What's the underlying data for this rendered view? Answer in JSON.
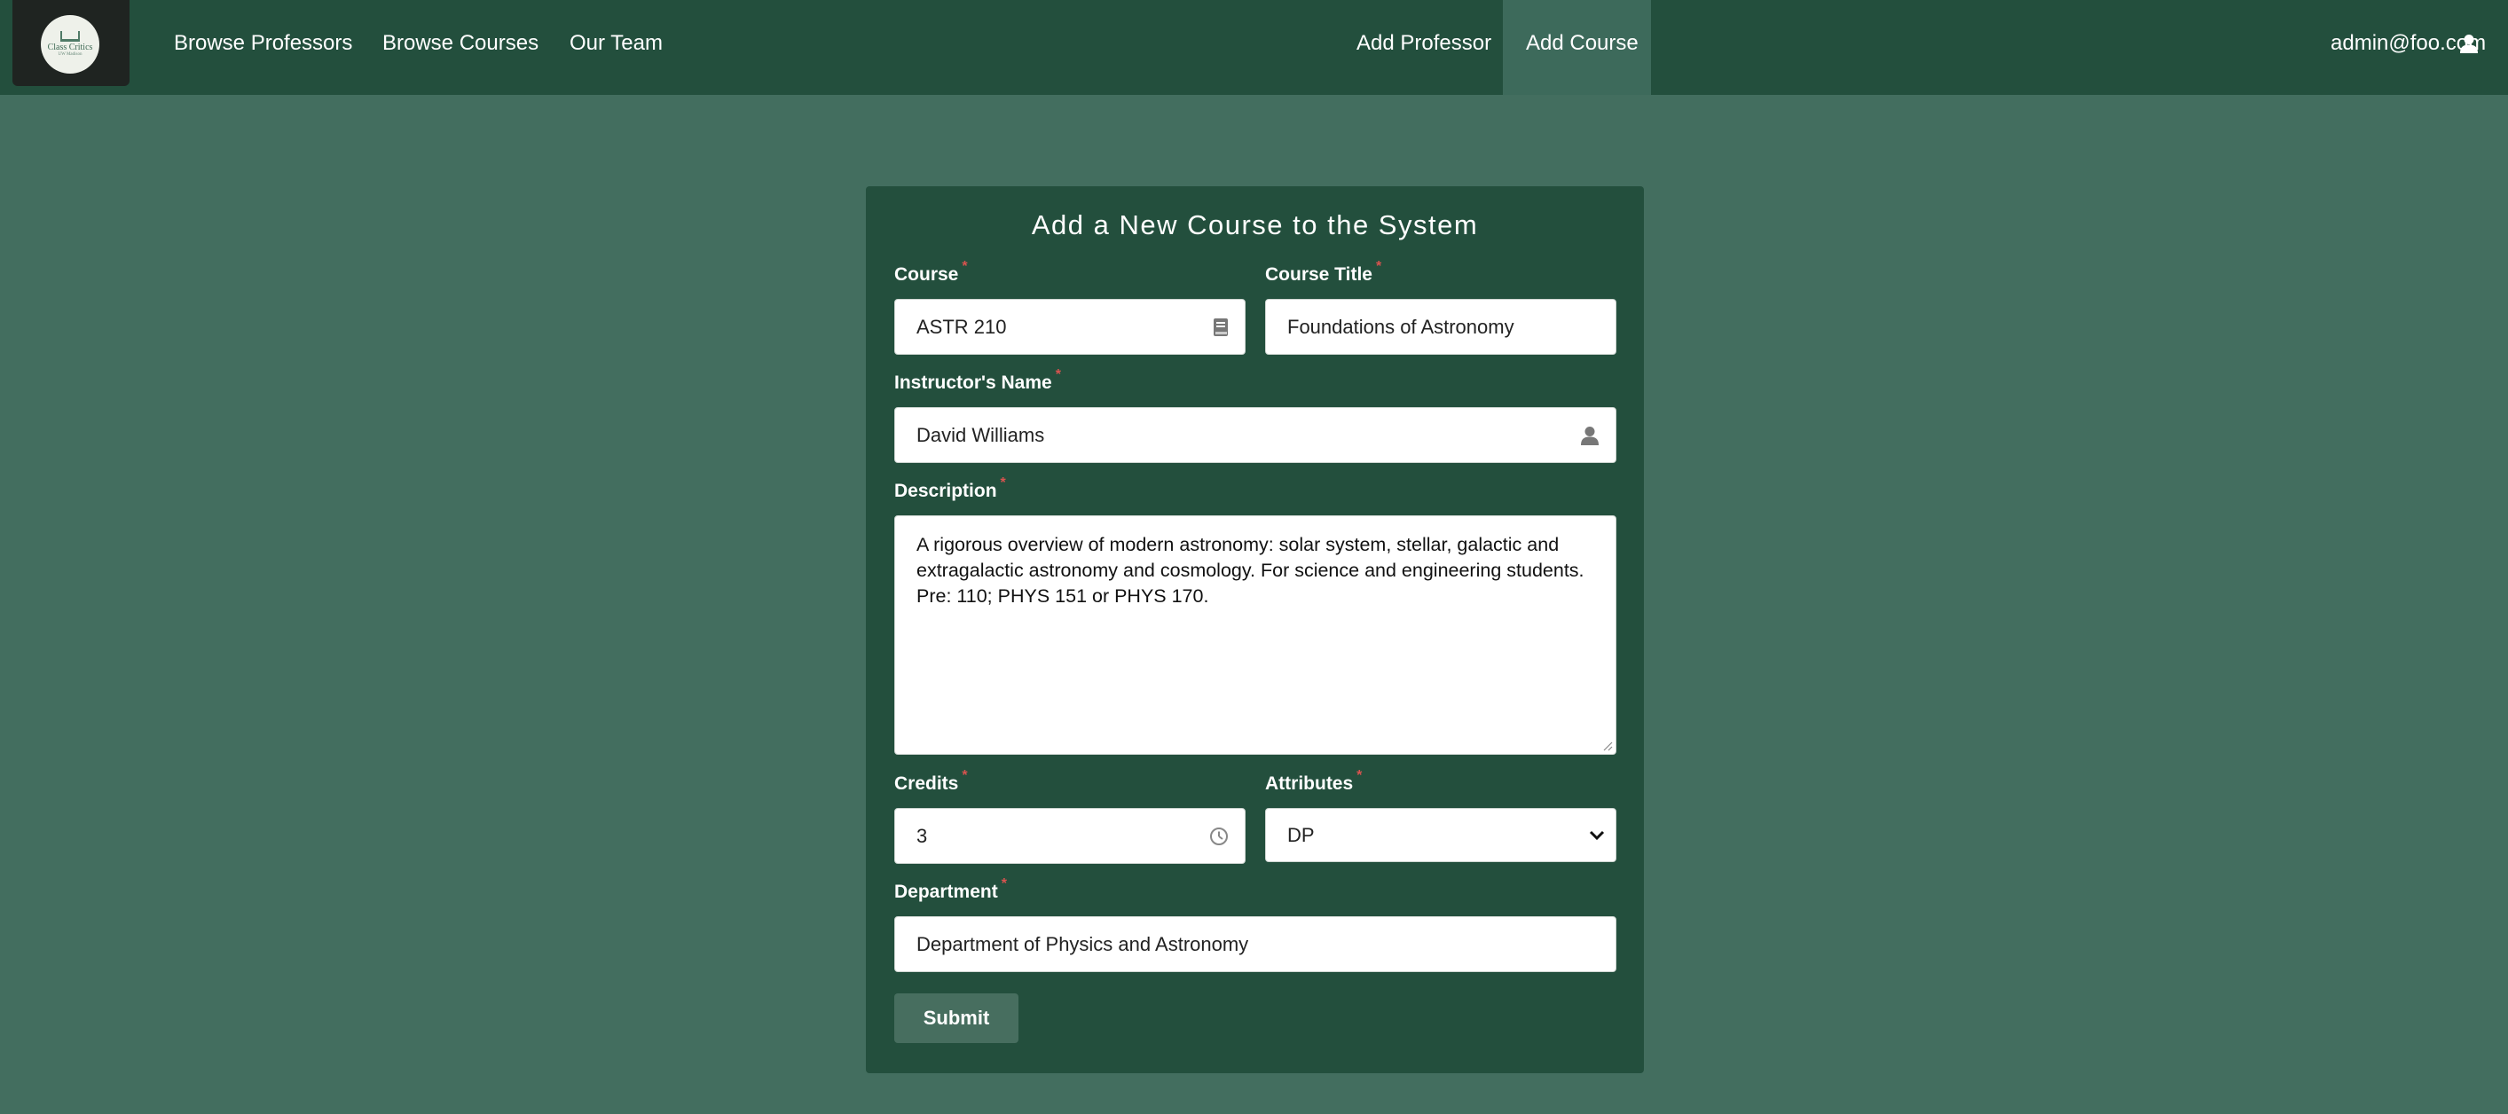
{
  "nav": {
    "logo_text": "Class Critics",
    "logo_subtext": "UW Madison",
    "links": [
      "Browse Professors",
      "Browse Courses",
      "Our Team"
    ],
    "add_professor": "Add Professor",
    "add_course": "Add Course",
    "user_email": "admin@foo.com"
  },
  "form": {
    "title": "Add a New Course to the System",
    "required_mark": "*",
    "course": {
      "label": "Course",
      "value": "ASTR 210",
      "icon": "book-icon"
    },
    "course_title": {
      "label": "Course Title",
      "value": "Foundations of Astronomy"
    },
    "instructor": {
      "label": "Instructor's Name",
      "value": "David Williams",
      "icon": "user-icon"
    },
    "description": {
      "label": "Description",
      "value": "A rigorous overview of modern astronomy: solar system, stellar, galactic and extragalactic astronomy and cosmology. For science and engineering students. Pre: 110; PHYS 151 or PHYS 170."
    },
    "credits": {
      "label": "Credits",
      "value": "3",
      "icon": "clock-icon"
    },
    "attributes": {
      "label": "Attributes",
      "value": "DP"
    },
    "department": {
      "label": "Department",
      "value": "Department of Physics and Astronomy"
    },
    "submit_label": "Submit"
  },
  "colors": {
    "page_bg": "#436e5f",
    "nav_bg": "#234f3d",
    "card_bg": "#234f3d",
    "active_nav": "#3d6a5b",
    "required": "#d9534f",
    "submit_bg": "#476e5f"
  }
}
